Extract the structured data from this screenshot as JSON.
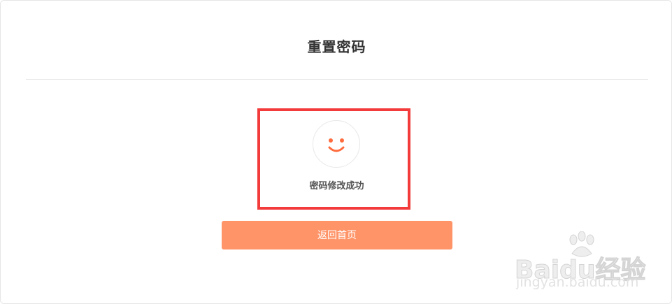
{
  "page": {
    "title": "重置密码"
  },
  "result": {
    "icon": "smiley-face-icon",
    "message": "密码修改成功"
  },
  "actions": {
    "home_button_label": "返回首页"
  },
  "watermark": {
    "brand": "Baidu经验",
    "url": "jingyan.baidu.com"
  },
  "colors": {
    "accent": "#ff9468",
    "smiley": "#ff6b3d",
    "highlight_border": "#f33b3b",
    "title_text": "#333333"
  }
}
